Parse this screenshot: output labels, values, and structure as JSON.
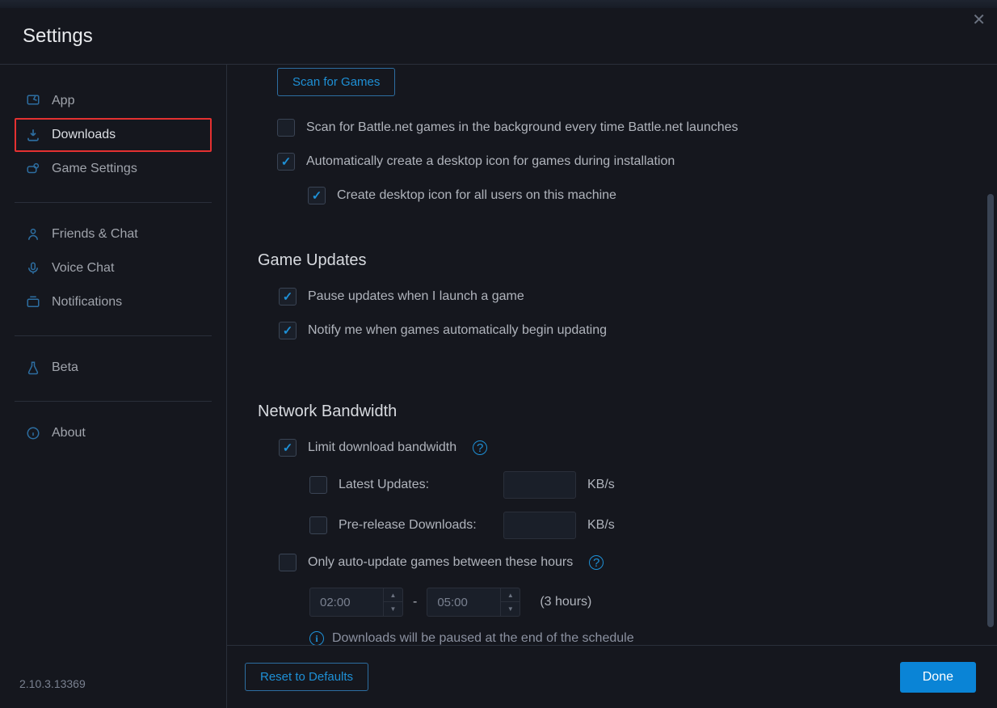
{
  "header": {
    "title": "Settings"
  },
  "sidebar": {
    "items": [
      {
        "label": "App"
      },
      {
        "label": "Downloads"
      },
      {
        "label": "Game Settings"
      },
      {
        "label": "Friends & Chat"
      },
      {
        "label": "Voice Chat"
      },
      {
        "label": "Notifications"
      },
      {
        "label": "Beta"
      },
      {
        "label": "About"
      }
    ],
    "version": "2.10.3.13369"
  },
  "content": {
    "scan_button": "Scan for Games",
    "scan_background_label": "Scan for Battle.net games in the background every time Battle.net launches",
    "auto_desktop_icon_label": "Automatically create a desktop icon for games during installation",
    "desktop_icon_all_users_label": "Create desktop icon for all users on this machine",
    "game_updates_title": "Game Updates",
    "pause_updates_label": "Pause updates when I launch a game",
    "notify_updates_label": "Notify me when games automatically begin updating",
    "bandwidth_title": "Network Bandwidth",
    "limit_bandwidth_label": "Limit download bandwidth",
    "latest_updates_label": "Latest Updates:",
    "prerelease_label": "Pre-release Downloads:",
    "kbps_unit": "KB/s",
    "auto_update_hours_label": "Only auto-update games between these hours",
    "time_start": "02:00",
    "time_end": "05:00",
    "hours_note": "(3 hours)",
    "schedule_info": "Downloads will be paused at the end of the schedule"
  },
  "footer": {
    "reset_label": "Reset to Defaults",
    "done_label": "Done"
  }
}
